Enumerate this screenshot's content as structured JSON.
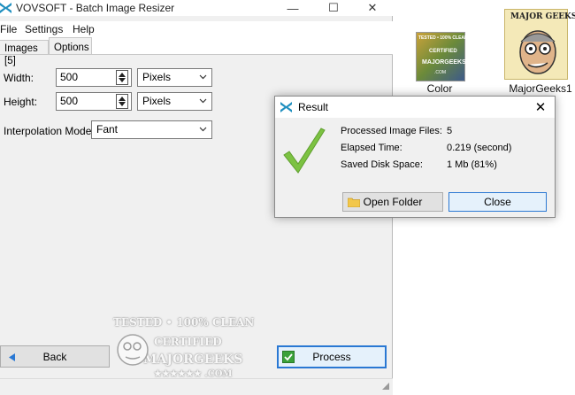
{
  "window": {
    "title": "VOVSOFT - Batch Image Resizer",
    "controls": {
      "minimize": "—",
      "maximize": "☐",
      "close": "✕"
    }
  },
  "menu": [
    "File",
    "Settings",
    "Help"
  ],
  "tabs": [
    {
      "label": "Images [5]",
      "active": false
    },
    {
      "label": "Options",
      "active": true
    }
  ],
  "options": {
    "width": {
      "label": "Width:",
      "value": "500",
      "unit": "Pixels"
    },
    "height": {
      "label": "Height:",
      "value": "500",
      "unit": "Pixels"
    },
    "interpolation": {
      "label": "Interpolation Mode:",
      "value": "Fant"
    }
  },
  "buttons": {
    "back": "Back",
    "process": "Process"
  },
  "watermark": {
    "line1": "TESTED • 100% CLEAN",
    "line2": "CERTIFIED",
    "line3": "MAJORGEEKS",
    "line4": "★★★★★★ .COM"
  },
  "desktop": {
    "icons": [
      {
        "label": "Color"
      },
      {
        "label": "MajorGeeks1"
      }
    ],
    "thumb_text": {
      "tested": "TESTED • 100% CLEAN",
      "certified": "CERTIFIED",
      "mg": "MAJORGEEKS",
      "com": ".COM",
      "logo": "MAJOR GEEKS"
    }
  },
  "dialog": {
    "title": "Result",
    "close": "✕",
    "rows": [
      {
        "label": "Processed Image Files:",
        "value": "5"
      },
      {
        "label": "Elapsed Time:",
        "value": "0.219 (second)"
      },
      {
        "label": "Saved Disk Space:",
        "value": "1 Mb (81%)"
      }
    ],
    "open_folder": "Open Folder",
    "close_button": "Close"
  },
  "colors": {
    "accent": "#2a78d3",
    "check_green": "#7cc242",
    "app_icon": "#1f8fbf"
  }
}
